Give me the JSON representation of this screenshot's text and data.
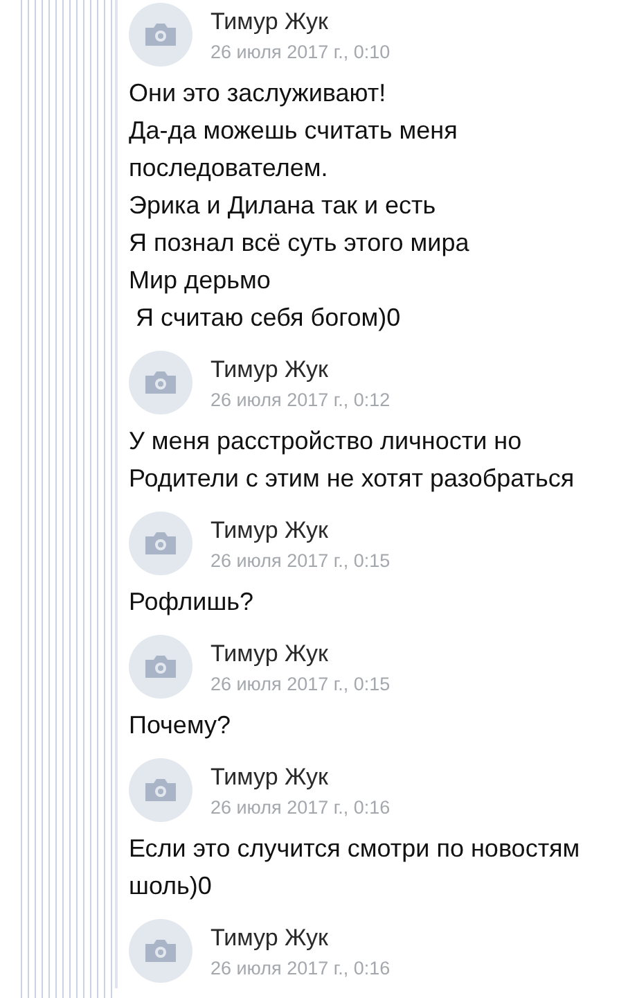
{
  "messages": [
    {
      "author": "Тимур Жук",
      "time": "26 июля 2017 г., 0:10",
      "lines": [
        "Они это заслуживают!",
        "Да-да можешь считать меня последователем.",
        "Эрика и Дилана так и есть",
        "Я познал всё суть этого мира",
        "Мир дерьмо",
        " Я считаю себя богом)0"
      ]
    },
    {
      "author": "Тимур Жук",
      "time": "26 июля 2017 г., 0:12",
      "lines": [
        "У меня расстройство личности но",
        "Родители с этим не хотят разобраться"
      ]
    },
    {
      "author": "Тимур Жук",
      "time": "26 июля 2017 г., 0:15",
      "lines": [
        "Рофлишь?"
      ]
    },
    {
      "author": "Тимур Жук",
      "time": "26 июля 2017 г., 0:15",
      "lines": [
        "Почему?"
      ]
    },
    {
      "author": "Тимур Жук",
      "time": "26 июля 2017 г., 0:16",
      "lines": [
        "Если это случится смотри по новостям шоль)0"
      ]
    },
    {
      "author": "Тимур Жук",
      "time": "26 июля 2017 г., 0:16"
    }
  ]
}
